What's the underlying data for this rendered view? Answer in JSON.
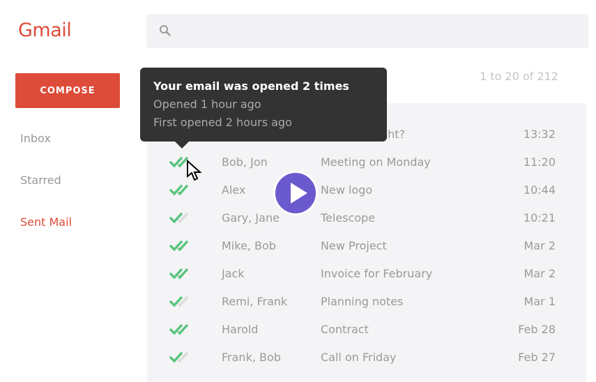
{
  "app": {
    "title": "Gmail",
    "compose_label": "COMPOSE"
  },
  "nav": [
    {
      "label": "Inbox"
    },
    {
      "label": "Starred"
    },
    {
      "label": "Sent Mail",
      "active": true
    }
  ],
  "search": {
    "placeholder": ""
  },
  "pager": "1 to 20 of 212",
  "colors": {
    "accent": "#dd4b39",
    "check_read": "#5cc47f",
    "check_unread": "#dcdcdc",
    "play": "#6a5acd"
  },
  "tooltip": {
    "title": "Your email was opened 2 times",
    "line1": "Opened 1 hour ago",
    "line2": "First opened 2 hours ago"
  },
  "rows": [
    {
      "name": "",
      "subject": "ght?",
      "time": "13:32",
      "opened": true
    },
    {
      "name": "Bob, Jon",
      "subject": "Meeting on Monday",
      "time": "11:20",
      "opened": true
    },
    {
      "name": "Alex",
      "subject": "New logo",
      "time": "10:44",
      "opened": true
    },
    {
      "name": "Gary, Jane",
      "subject": "Telescope",
      "time": "10:21",
      "opened": false
    },
    {
      "name": "Mike, Bob",
      "subject": "New Project",
      "time": "Mar 2",
      "opened": true
    },
    {
      "name": "Jack",
      "subject": "Invoice for February",
      "time": "Mar 2",
      "opened": true
    },
    {
      "name": "Remi, Frank",
      "subject": "Planning notes",
      "time": "Mar 1",
      "opened": false
    },
    {
      "name": "Harold",
      "subject": "Contract",
      "time": "Feb 28",
      "opened": true
    },
    {
      "name": "Frank, Bob",
      "subject": "Call on Friday",
      "time": "Feb 27",
      "opened": false
    }
  ]
}
